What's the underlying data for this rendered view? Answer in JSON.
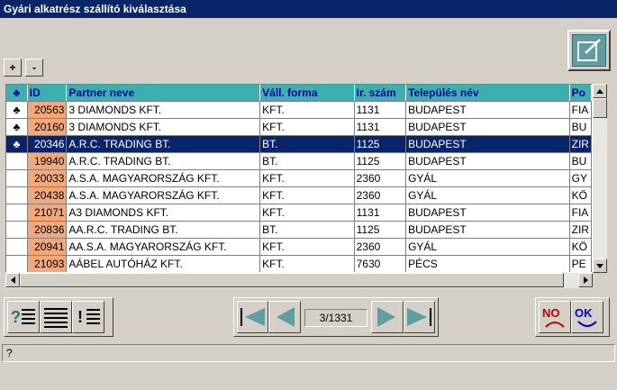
{
  "window": {
    "title": "Gyári alkatrész szállító kiválasztása"
  },
  "tree_buttons": {
    "expand": "+",
    "collapse": "-"
  },
  "grid": {
    "header_marker": "♣",
    "columns": [
      "ID",
      "Partner neve",
      "Váll. forma",
      "Ir. szám",
      "Település név",
      "Po"
    ],
    "rows": [
      {
        "marker": "♣",
        "id": "20563",
        "name": "3 DIAMONDS KFT.",
        "form": "KFT.",
        "zip": "1131",
        "city": "BUDAPEST",
        "extra": "FIA",
        "selected": false
      },
      {
        "marker": "♣",
        "id": "20160",
        "name": "3 DIAMONDS KFT.",
        "form": "KFT.",
        "zip": "1131",
        "city": "BUDAPEST",
        "extra": "BU",
        "selected": false
      },
      {
        "marker": "♣",
        "id": "20346",
        "name": "A.R.C. TRADING BT.",
        "form": "BT.",
        "zip": "1125",
        "city": "BUDAPEST",
        "extra": "ZIR",
        "selected": true
      },
      {
        "marker": "",
        "id": "19940",
        "name": "A.R.C. TRADING BT.",
        "form": "BT.",
        "zip": "1125",
        "city": "BUDAPEST",
        "extra": "BU",
        "selected": false
      },
      {
        "marker": "",
        "id": "20033",
        "name": "A.S.A. MAGYARORSZÁG KFT.",
        "form": "KFT.",
        "zip": "2360",
        "city": "GYÁL",
        "extra": "GY",
        "selected": false
      },
      {
        "marker": "",
        "id": "20438",
        "name": "A.S.A. MAGYARORSZÁG KFT.",
        "form": "KFT.",
        "zip": "2360",
        "city": "GYÁL",
        "extra": "KÖ",
        "selected": false
      },
      {
        "marker": "",
        "id": "21071",
        "name": "A3 DIAMONDS KFT.",
        "form": "KFT.",
        "zip": "1131",
        "city": "BUDAPEST",
        "extra": "FIA",
        "selected": false
      },
      {
        "marker": "",
        "id": "20836",
        "name": "AA.R.C. TRADING BT.",
        "form": "BT.",
        "zip": "1125",
        "city": "BUDAPEST",
        "extra": "ZIR",
        "selected": false
      },
      {
        "marker": "",
        "id": "20941",
        "name": "AA.S.A. MAGYARORSZÁG KFT.",
        "form": "KFT.",
        "zip": "2360",
        "city": "GYÁL",
        "extra": "KÖ",
        "selected": false
      },
      {
        "marker": "",
        "id": "21093",
        "name": "AÁBEL AUTÓHÁZ KFT.",
        "form": "KFT.",
        "zip": "7630",
        "city": "PÉCS",
        "extra": "PE",
        "selected": false
      }
    ]
  },
  "pager": {
    "position": "3/1331"
  },
  "actions": {
    "no_label": "NO",
    "ok_label": "OK"
  },
  "status": {
    "text": "?"
  },
  "colors": {
    "title_bg": "#0a246a",
    "header_bg": "#3cb0b0",
    "id_bg": "#f3a87a",
    "accent": "#5f9ea0"
  }
}
